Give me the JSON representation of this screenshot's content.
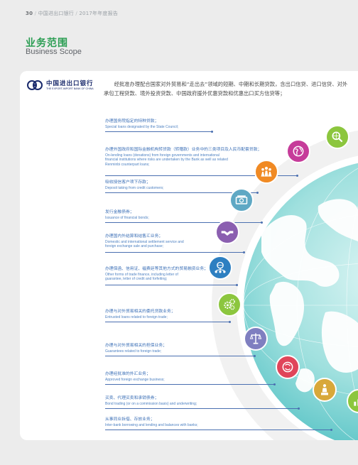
{
  "header": {
    "page_number": "30",
    "bank_name": "中国进出口银行",
    "report_title": "2017年年度报告"
  },
  "title": {
    "zh": "业务范围",
    "en": "Business Scope"
  },
  "logo": {
    "zh": "中国进出口银行",
    "en": "THE EXPORT-IMPORT BANK OF CHINA"
  },
  "intro": "经批准办理配合国家对外贸易和“走出去”领域的短期、中期和长期贷款，含出口信贷、进口信贷、对外承包工程贷款、境外投资贷款、中国政府援外优惠贷款和优惠出口买方信贷等；",
  "items": [
    {
      "zh": "办理国务院指定的特种贷款；",
      "en": [
        "Special loans designated by the State Council;"
      ]
    },
    {
      "zh": "办理外国政府和国际金融机构转贷款（转赠款）业务中的三类项目及人民币配套贷款；",
      "en": [
        "On-lending loans (donations) from foreign governments and international",
        "financial institutions where risks are undertaken by the Bank as well as related",
        "Renminbi counterpart loans;"
      ]
    },
    {
      "zh": "吸收授信客户项下存款；",
      "en": [
        "Deposit taking from credit customers;"
      ]
    },
    {
      "zh": "发行金融债券；",
      "en": [
        "Issuance of financial bonds;"
      ]
    },
    {
      "zh": "办理国内外结算和结售汇业务；",
      "en": [
        "Domestic and international settlement service and",
        "foreign exchange sale and purchase;"
      ]
    },
    {
      "zh": "办理保函、信用证、福费廷等其他方式的贸易融资业务；",
      "en": [
        "Other forms of trade finance, including letter of",
        "guarantee, letter of credit and forfeiting;"
      ]
    },
    {
      "zh": "办理与对外贸易相关的委托贷款业务；",
      "en": [
        "Entrusted loans related to foreign trade;"
      ]
    },
    {
      "zh": "办理与对外贸易相关的担保业务；",
      "en": [
        "Guarantees related to foreign trade;"
      ]
    },
    {
      "zh": "办理经批准的外汇业务；",
      "en": [
        "Approved foreign exchange business;"
      ]
    },
    {
      "zh": "买卖、代理买卖和承销债券；",
      "en": [
        "Bond trading (or on a commission basis) and underwriting;"
      ]
    },
    {
      "zh": "从事同业拆借、存放业务；",
      "en": [
        "Inter-bank borrowing and lending and balances with banks;"
      ]
    }
  ],
  "icons": [
    {
      "name": "search-globe-icon",
      "color": "#8cc63e"
    },
    {
      "name": "globe-icon",
      "color": "#c63c9a"
    },
    {
      "name": "people-group-icon",
      "color": "#f08a24"
    },
    {
      "name": "money-icon",
      "color": "#5fa8c4"
    },
    {
      "name": "handshake-icon",
      "color": "#8b5fb0"
    },
    {
      "name": "network-globe-icon",
      "color": "#2d7fc1"
    },
    {
      "name": "gears-icon",
      "color": "#8cc63e"
    },
    {
      "name": "scales-icon",
      "color": "#7f7fc0"
    },
    {
      "name": "currency-exchange-icon",
      "color": "#e0455a"
    },
    {
      "name": "person-podium-icon",
      "color": "#d8a83a"
    },
    {
      "name": "bar-chart-icon",
      "color": "#8cc63e"
    }
  ],
  "colors": {
    "accent_green": "#2a9d52",
    "text_blue": "#3b6fb6",
    "globe_teal": "#7fd4d8"
  }
}
